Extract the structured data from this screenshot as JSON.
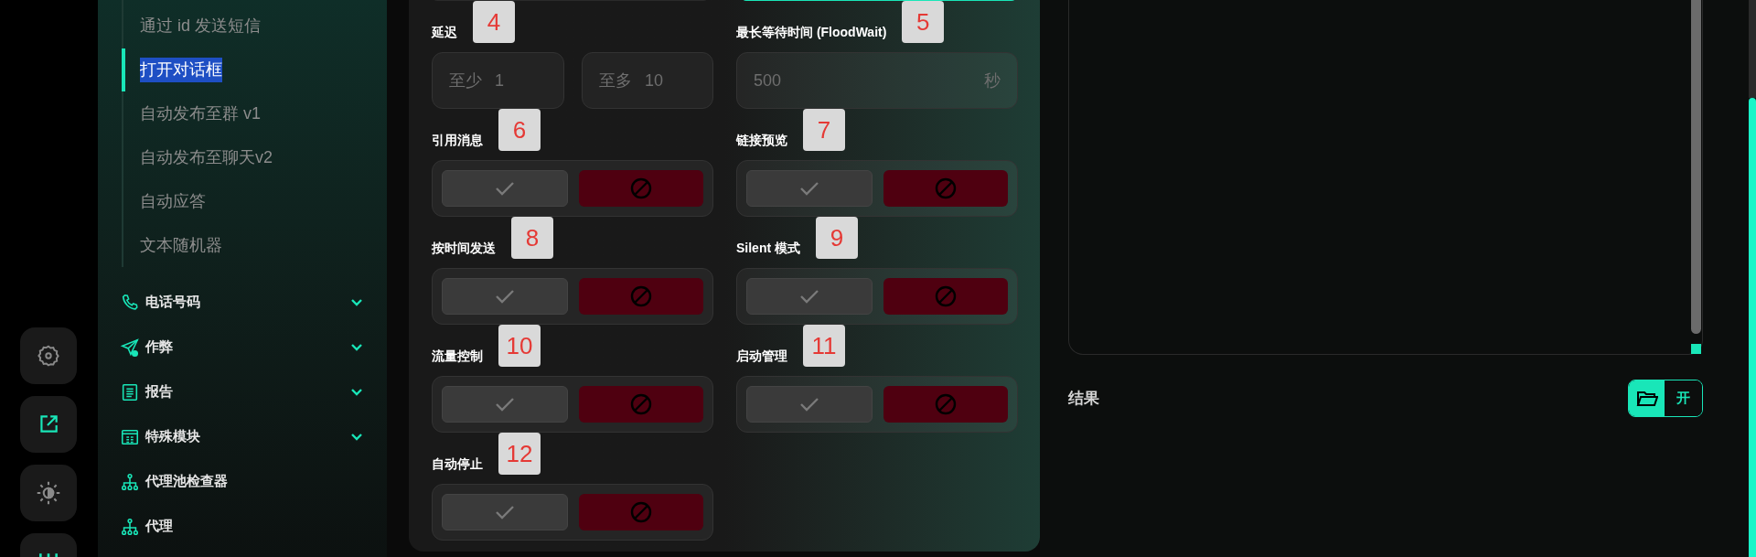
{
  "rail": [
    {
      "kind": "gear"
    },
    {
      "kind": "share"
    },
    {
      "kind": "theme"
    },
    {
      "kind": "chart"
    }
  ],
  "sidebar": {
    "submenu": [
      {
        "label": "通过 id 发送短信",
        "selected": false
      },
      {
        "label": "打开对话框",
        "selected": true
      },
      {
        "label": "自动发布至群 v1",
        "selected": false
      },
      {
        "label": "自动发布至聊天v2",
        "selected": false
      },
      {
        "label": "自动应答",
        "selected": false
      },
      {
        "label": "文本随机器",
        "selected": false
      }
    ],
    "groups": [
      {
        "label": "电话号码",
        "kind": "phone",
        "expandable": true
      },
      {
        "label": "作弊",
        "kind": "send",
        "expandable": true
      },
      {
        "label": "报告",
        "kind": "report",
        "expandable": true
      },
      {
        "label": "特殊模块",
        "kind": "module",
        "expandable": true
      },
      {
        "label": "代理池检查器",
        "kind": "network",
        "expandable": false
      },
      {
        "label": "代理",
        "kind": "network",
        "expandable": false
      }
    ]
  },
  "form": {
    "delay": {
      "label": "延迟",
      "badge": "4",
      "min": {
        "prefix": "至少",
        "value": "1"
      },
      "max": {
        "prefix": "至多",
        "value": "10"
      }
    },
    "flood_wait": {
      "label": "最长等待时间 (FloodWait)",
      "badge": "5",
      "value": "500",
      "suffix": "秒"
    },
    "toggles": [
      {
        "label": "引用消息",
        "badge": "6",
        "on": false
      },
      {
        "label": "链接预览",
        "badge": "7",
        "on": false
      },
      {
        "label": "按时间发送",
        "badge": "8",
        "on": false
      },
      {
        "label": "Silent 模式",
        "badge": "9",
        "on": false
      },
      {
        "label": "流量控制",
        "badge": "10",
        "on": false
      },
      {
        "label": "启动管理",
        "badge": "11",
        "on": false
      },
      {
        "label": "自动停止",
        "badge": "12",
        "on": false
      }
    ]
  },
  "result": {
    "label": "结果",
    "button": "开"
  }
}
